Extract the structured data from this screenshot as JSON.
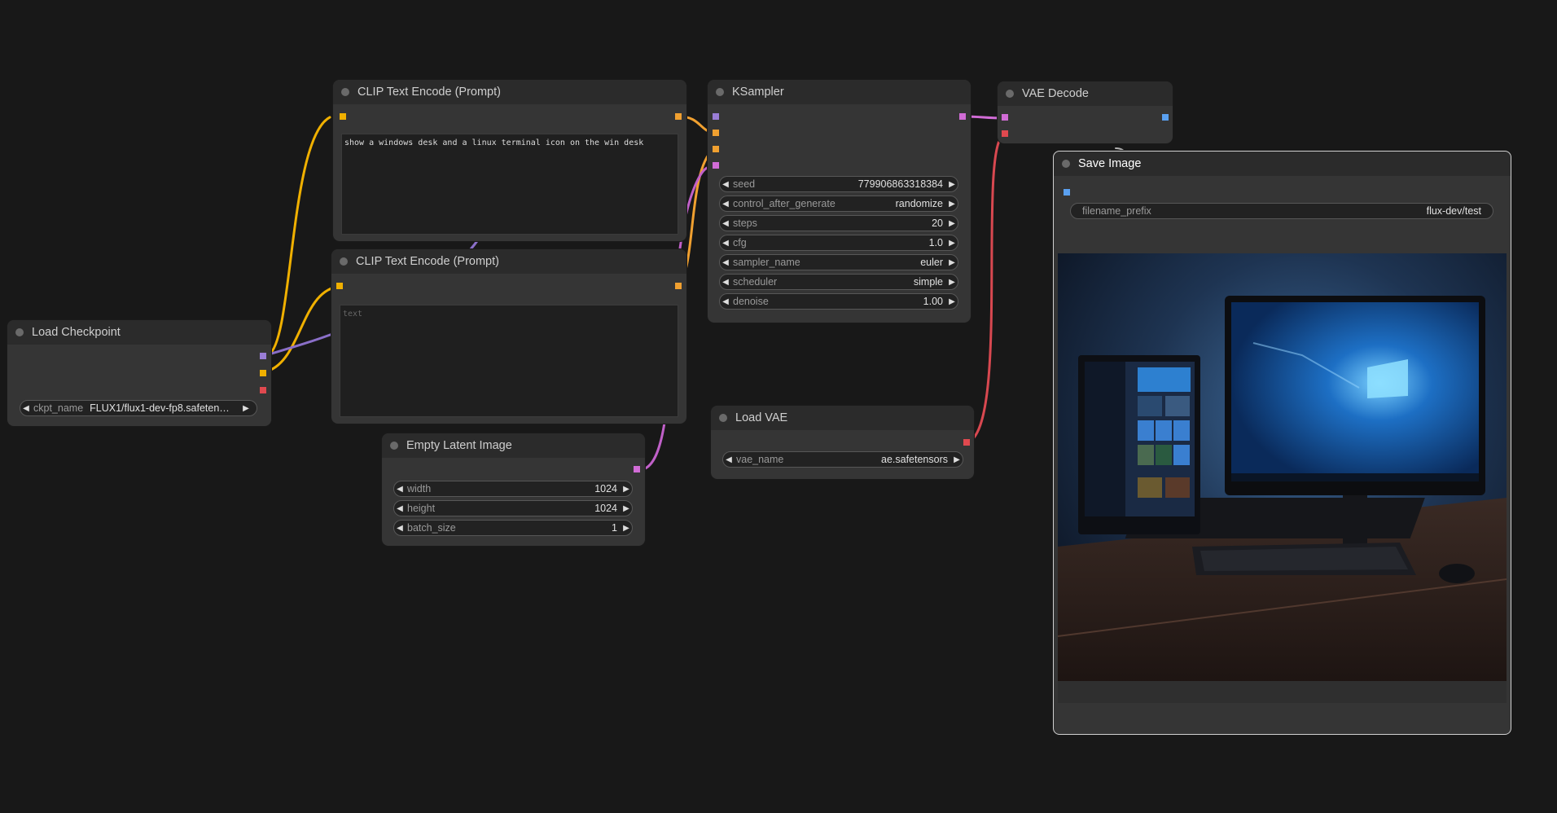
{
  "colors": {
    "clip": "#f0a812",
    "model": "#9a7ed6",
    "latent": "#d16cd6",
    "vae": "#e0494f",
    "image": "#5aa0f0",
    "conditioning": "#f0a030"
  },
  "nodes": {
    "load_checkpoint": {
      "title": "Load Checkpoint",
      "ckpt_label": "ckpt_name",
      "ckpt_value": "FLUX1/flux1-dev-fp8.safeten…"
    },
    "clip_pos": {
      "title": "CLIP Text Encode (Prompt)",
      "text": "show a windows desk and a linux terminal icon on the win desk"
    },
    "clip_neg": {
      "title": "CLIP Text Encode (Prompt)",
      "placeholder": "text"
    },
    "ksampler": {
      "title": "KSampler",
      "widgets": [
        {
          "name": "seed",
          "value": "779906863318384"
        },
        {
          "name": "control_after_generate",
          "value": "randomize"
        },
        {
          "name": "steps",
          "value": "20"
        },
        {
          "name": "cfg",
          "value": "1.0"
        },
        {
          "name": "sampler_name",
          "value": "euler"
        },
        {
          "name": "scheduler",
          "value": "simple"
        },
        {
          "name": "denoise",
          "value": "1.00"
        }
      ]
    },
    "vae_decode": {
      "title": "VAE Decode"
    },
    "save_image": {
      "title": "Save Image",
      "prefix_label": "filename_prefix",
      "prefix_value": "flux-dev/test"
    },
    "empty_latent": {
      "title": "Empty Latent Image",
      "widgets": [
        {
          "name": "width",
          "value": "1024"
        },
        {
          "name": "height",
          "value": "1024"
        },
        {
          "name": "batch_size",
          "value": "1"
        }
      ]
    },
    "load_vae": {
      "title": "Load VAE",
      "vae_label": "vae_name",
      "vae_value": "ae.safetensors"
    }
  },
  "icons": {
    "arrow_left": "◀",
    "arrow_right": "▶"
  }
}
